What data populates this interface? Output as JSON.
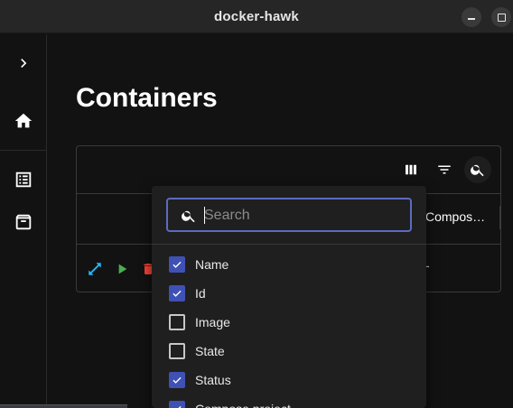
{
  "window": {
    "title": "docker-hawk"
  },
  "page": {
    "title": "Containers"
  },
  "table": {
    "visible_header": "Compos…",
    "visible_cell": "-"
  },
  "column_picker": {
    "search_placeholder": "Search",
    "options": [
      {
        "label": "Name",
        "checked": true
      },
      {
        "label": "Id",
        "checked": true
      },
      {
        "label": "Image",
        "checked": false
      },
      {
        "label": "State",
        "checked": false
      },
      {
        "label": "Status",
        "checked": true
      },
      {
        "label": "Compose project",
        "checked": true
      }
    ]
  },
  "colors": {
    "accent": "#3f51b5",
    "expand": "#29b6f6",
    "start": "#4caf50",
    "delete": "#f44336"
  }
}
